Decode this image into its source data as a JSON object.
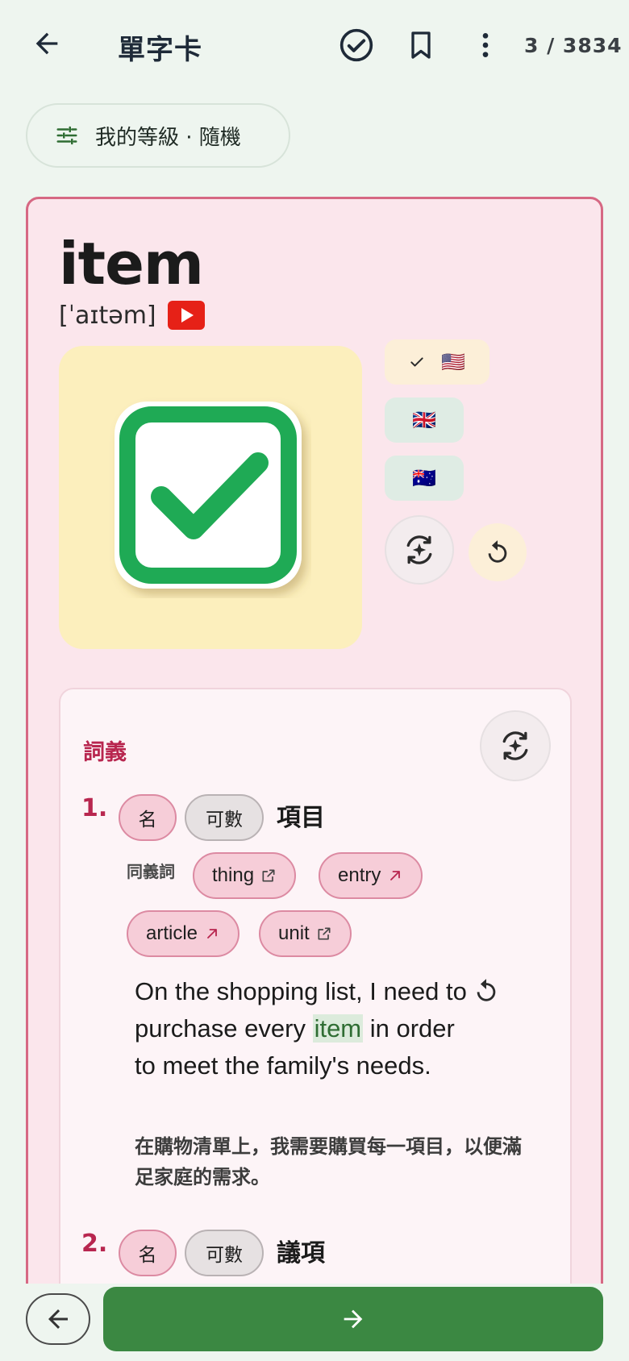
{
  "header": {
    "title": "單字卡",
    "counter": "3 / 3834",
    "icons": [
      "back-arrow-icon",
      "check-circle-icon",
      "bookmark-icon",
      "more-vert-icon"
    ]
  },
  "filter": {
    "label": "我的等級 · 隨機"
  },
  "card": {
    "word": "item",
    "phonetic": "[ˈaɪtəm]",
    "accents": [
      {
        "flag": "🇺🇸",
        "selected": true
      },
      {
        "flag": "🇬🇧",
        "selected": false
      },
      {
        "flag": "🇦🇺",
        "selected": false
      }
    ],
    "definitions": {
      "title": "詞義",
      "senses": [
        {
          "number": "1.",
          "pos": "名",
          "countable": "可數",
          "meaning": "項目",
          "synonyms_label": "同義詞",
          "synonyms": [
            "thing",
            "entry",
            "article",
            "unit"
          ],
          "example_parts": [
            "On the shopping list, I need to purchase every ",
            "item",
            " in order to meet the family's needs."
          ],
          "example_zh": "在購物清單上，我需要購買每一項目，以便滿足家庭的需求。"
        },
        {
          "number": "2.",
          "pos": "名",
          "countable": "可數",
          "meaning": "議項"
        }
      ]
    }
  },
  "colors": {
    "accent_green": "#3b8842",
    "accent_red": "#b8264f",
    "card_bg": "#fbe6ec"
  }
}
